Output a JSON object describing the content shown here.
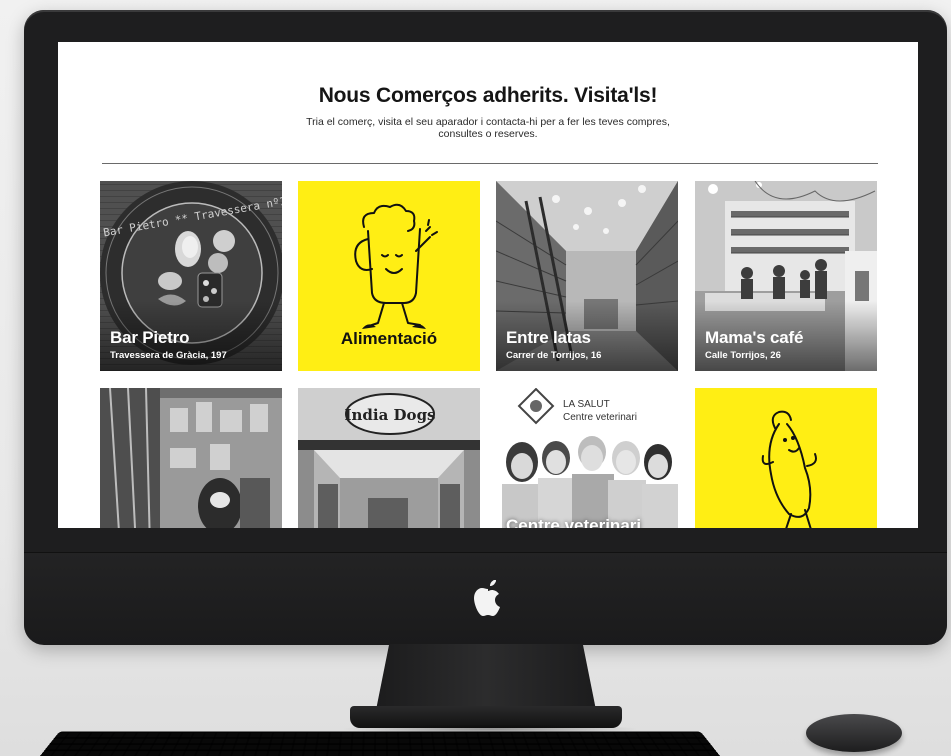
{
  "page": {
    "title": "Nous Comerços adherits. Visita'ls!",
    "subtitle": "Tria el comerç, visita el seu aparador i contacta-hi per a fer les teves compres, consultes o reserves."
  },
  "shops": [
    {
      "name": "Bar Pietro",
      "address": "Travessera de Gràcia, 197",
      "plate_text": "** Bar Pietro ** Travessera nº197"
    },
    {
      "name": "Alimentació"
    },
    {
      "name": "Entre latas",
      "address": "Carrer de Torrijos, 16"
    },
    {
      "name": "Mama's café",
      "address": "Calle Torrijos, 26"
    },
    {
      "name": ""
    },
    {
      "name": "",
      "sign_text": "India Dogs"
    },
    {
      "name": "Centre veterinari",
      "brand_line1": "LA SALUT",
      "brand_line2": "Centre veterinari"
    },
    {
      "name": ""
    }
  ],
  "colors": {
    "accent_yellow": "#ffee14",
    "bezel": "#1e1e1f",
    "screen_bg": "#ffffff"
  }
}
